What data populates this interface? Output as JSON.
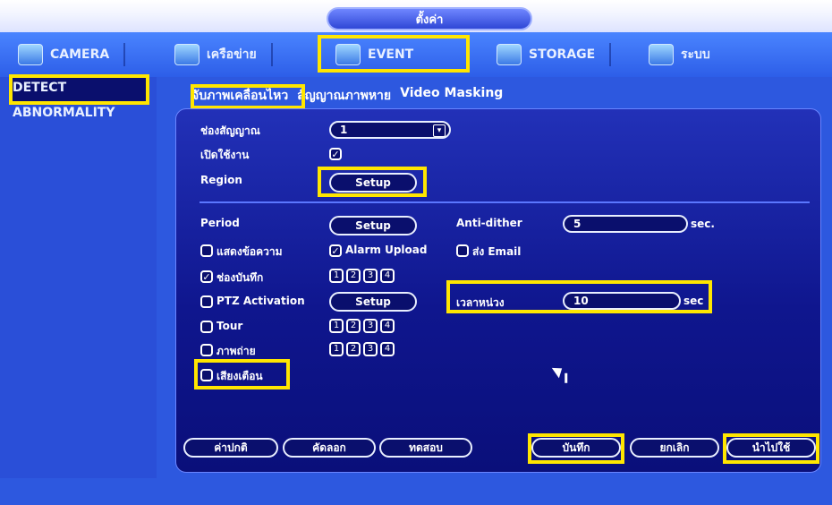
{
  "header": {
    "title": "ตั้งค่า"
  },
  "tabs": [
    {
      "label": "CAMERA",
      "icon": "camera-icon"
    },
    {
      "label": "เครือข่าย",
      "icon": "network-icon"
    },
    {
      "label": "EVENT",
      "icon": "event-icon"
    },
    {
      "label": "STORAGE",
      "icon": "storage-icon"
    },
    {
      "label": "ระบบ",
      "icon": "system-icon"
    }
  ],
  "left_nav": {
    "items": [
      "DETECT",
      "ABNORMALITY"
    ]
  },
  "subtabs": [
    "จับภาพเคลื่อนไหว",
    "สัญญาณภาพหาย",
    "Video Masking"
  ],
  "form": {
    "channel_label": "ช่องสัญญาณ",
    "channel_value": "1",
    "enable_label": "เปิดใช้งาน",
    "region_label": "Region",
    "setup_label": "Setup",
    "period_label": "Period",
    "anti_dither_label": "Anti-dither",
    "anti_dither_value": "5",
    "sec_label": "sec.",
    "show_message_label": "แสดงข้อความ",
    "alarm_upload_label": "Alarm Upload",
    "send_email_label": "ส่ง Email",
    "record_label": "ช่องบันทึก",
    "ptz_label": "PTZ Activation",
    "delay_label": "เวลาหน่วง",
    "delay_value": "10",
    "delay_unit": "sec",
    "tour_label": "Tour",
    "snapshot_label": "ภาพถ่าย",
    "buzzer_label": "เสียงเตือน",
    "numbers": [
      "1",
      "2",
      "3",
      "4"
    ]
  },
  "footer_buttons": {
    "default": "ค่าปกติ",
    "copy": "คัดลอก",
    "test": "ทดสอบ",
    "save": "บันทึก",
    "cancel": "ยกเลิก",
    "apply": "นำไปใช้"
  },
  "colors": {
    "highlight": "#ffe600",
    "panel_blue": "#2d58df",
    "dark_blue": "#0a0f6d"
  }
}
